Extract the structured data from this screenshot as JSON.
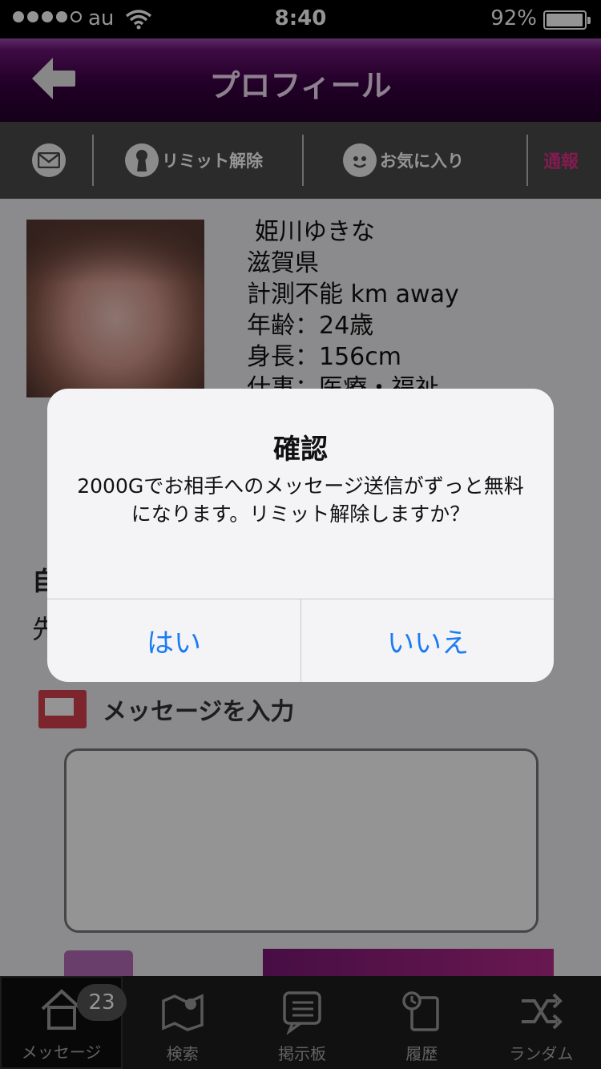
{
  "status_bar": {
    "carrier": "au",
    "time": "8:40",
    "battery_percent": "92%",
    "battery_level": 0.92
  },
  "header": {
    "title": "プロフィール"
  },
  "action_bar": {
    "limit_release_label": "リミット解除",
    "favorite_label": "お気に入り",
    "report_label": "通報",
    "report_color": "#e0308a"
  },
  "profile": {
    "name": "姫川ゆきな",
    "prefecture": "滋賀県",
    "distance": "計測不能 km away",
    "age": "年齢：24歳",
    "height": "身長：156cm",
    "job": "仕事：医療・福祉"
  },
  "sections": {
    "self_intro_char": "自",
    "second_char": "先"
  },
  "message_section": {
    "label": "メッセージを入力"
  },
  "alert": {
    "title": "確認",
    "message": "2000Gでお相手へのメッセージ送信がずっと無料になります。リミット解除しますか？",
    "yes_label": "はい",
    "no_label": "いいえ",
    "button_color": "#1c7cf4"
  },
  "tab_bar": {
    "tabs": [
      {
        "label": "メッセージ",
        "icon": "house-icon",
        "badge": "23",
        "active": true
      },
      {
        "label": "検索",
        "icon": "map-icon"
      },
      {
        "label": "掲示板",
        "icon": "board-icon"
      },
      {
        "label": "履歴",
        "icon": "history-icon"
      },
      {
        "label": "ランダム",
        "icon": "shuffle-icon"
      }
    ]
  },
  "colors": {
    "header_purple": "#3a0044",
    "action_bar_gray": "#4b4b4b",
    "tab_bar_bg": "#1e1e1e"
  }
}
